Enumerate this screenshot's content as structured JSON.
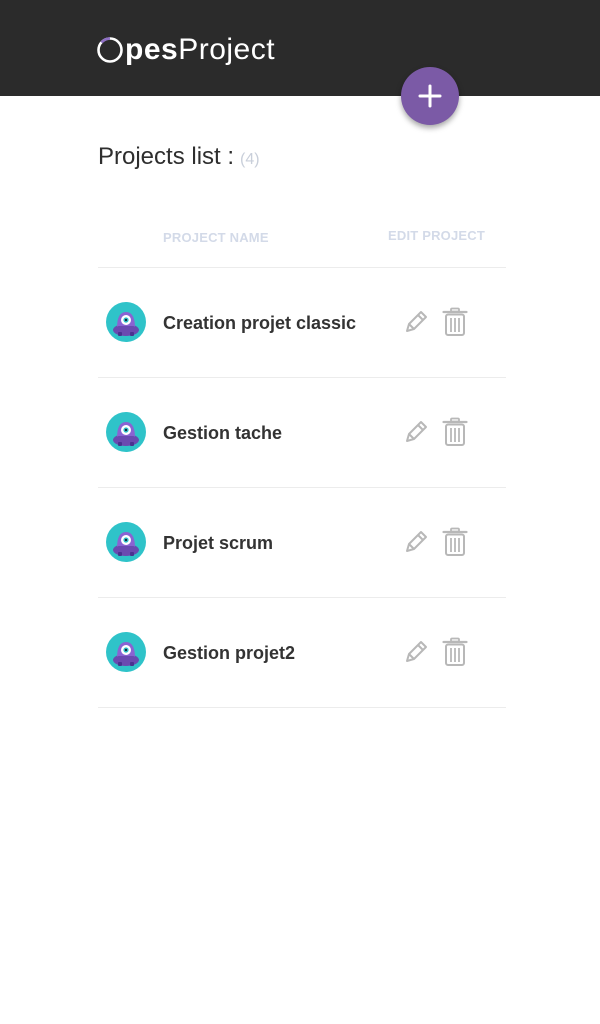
{
  "header": {
    "logo_bold": "pes",
    "logo_light": "Project",
    "add_icon": "plus-icon",
    "accent_color": "#7b5aa6"
  },
  "page": {
    "title": "Projects list :",
    "count": "(4)"
  },
  "table": {
    "col_name": "PROJECT NAME",
    "col_edit": "EDIT PROJECT",
    "rows": [
      {
        "name": "Creation projet classic",
        "avatar_icon": "robot-avatar-icon",
        "edit_icon": "pencil-icon",
        "delete_icon": "trash-icon"
      },
      {
        "name": "Gestion tache",
        "avatar_icon": "robot-avatar-icon",
        "edit_icon": "pencil-icon",
        "delete_icon": "trash-icon"
      },
      {
        "name": "Projet scrum",
        "avatar_icon": "robot-avatar-icon",
        "edit_icon": "pencil-icon",
        "delete_icon": "trash-icon"
      },
      {
        "name": "Gestion projet2",
        "avatar_icon": "robot-avatar-icon",
        "edit_icon": "pencil-icon",
        "delete_icon": "trash-icon"
      }
    ]
  }
}
